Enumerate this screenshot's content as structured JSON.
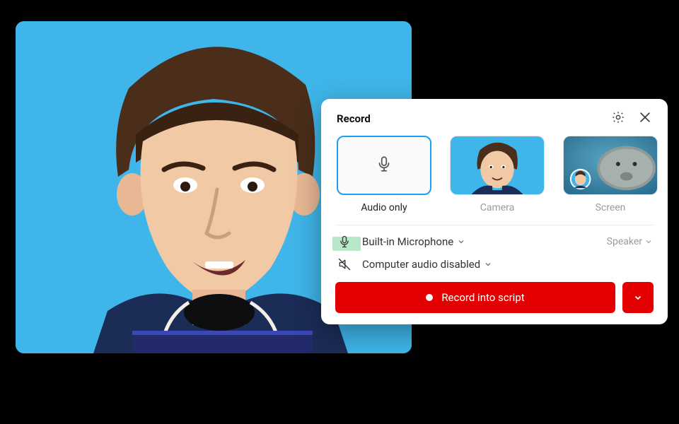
{
  "panel": {
    "title": "Record",
    "options": [
      {
        "label": "Audio only"
      },
      {
        "label": "Camera"
      },
      {
        "label": "Screen"
      }
    ],
    "mic": {
      "device": "Built-in Microphone",
      "monitor": "Speaker"
    },
    "system_audio": {
      "status": "Computer audio disabled"
    },
    "record_button": "Record into script"
  }
}
